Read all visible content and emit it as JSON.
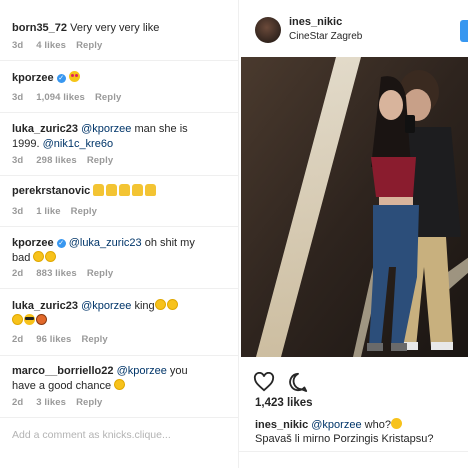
{
  "comments": [
    {
      "user": "born35_72",
      "text": "Very very very like",
      "time": "3d",
      "likes": "4 likes",
      "reply": "Reply"
    },
    {
      "user": "kporzee",
      "verified": true,
      "text": "",
      "emoji": "heart-eyes",
      "time": "3d",
      "likes": "1,094 likes",
      "reply": "Reply"
    },
    {
      "user": "luka_zuric23",
      "mention": "@kporzee",
      "text": " man she is",
      "text2": "1999.",
      "mention2": "@nik1c_kre6o",
      "time": "3d",
      "likes": "298 likes",
      "reply": "Reply"
    },
    {
      "user": "perekrstanovic",
      "text": "",
      "emoji": "thumbs-up x5",
      "time": "3d",
      "likes": "1 like",
      "reply": "Reply"
    },
    {
      "user": "kporzee",
      "verified": true,
      "mention": "@luka_zuric23",
      "text": " oh shit my",
      "text2": "bad",
      "time": "2d",
      "likes": "883 likes",
      "reply": "Reply"
    },
    {
      "user": "luka_zuric23",
      "mention": "@kporzee",
      "text": " king",
      "time": "2d",
      "likes": "96 likes",
      "reply": "Reply"
    },
    {
      "user": "marco__borriello22",
      "mention": "@kporzee",
      "text": " you",
      "text2": "have a good chance",
      "time": "2d",
      "likes": "3 likes",
      "reply": "Reply"
    }
  ],
  "add_comment_placeholder": "Add a comment as knicks.clique...",
  "post": {
    "username": "ines_nikic",
    "location": "CineStar Zagreb",
    "likes": "1,423 likes",
    "caption_user": "ines_nikic",
    "caption_mention": "@kporzee",
    "caption_text": " who?",
    "caption_line2": "Spavaš li mirno Porzingis Kristapsu?"
  },
  "colors": {
    "link": "#003569",
    "meta": "#999999",
    "verified": "#3897f0",
    "follow": "#3897f0"
  },
  "icons": [
    "verified-badge-icon",
    "heart-outline-icon",
    "comment-bubble-icon",
    "thinking-face-emoji",
    "laughing-emoji",
    "thumbs-up-emoji",
    "sunglasses-emoji",
    "basketball-emoji",
    "heart-eyes-emoji"
  ]
}
